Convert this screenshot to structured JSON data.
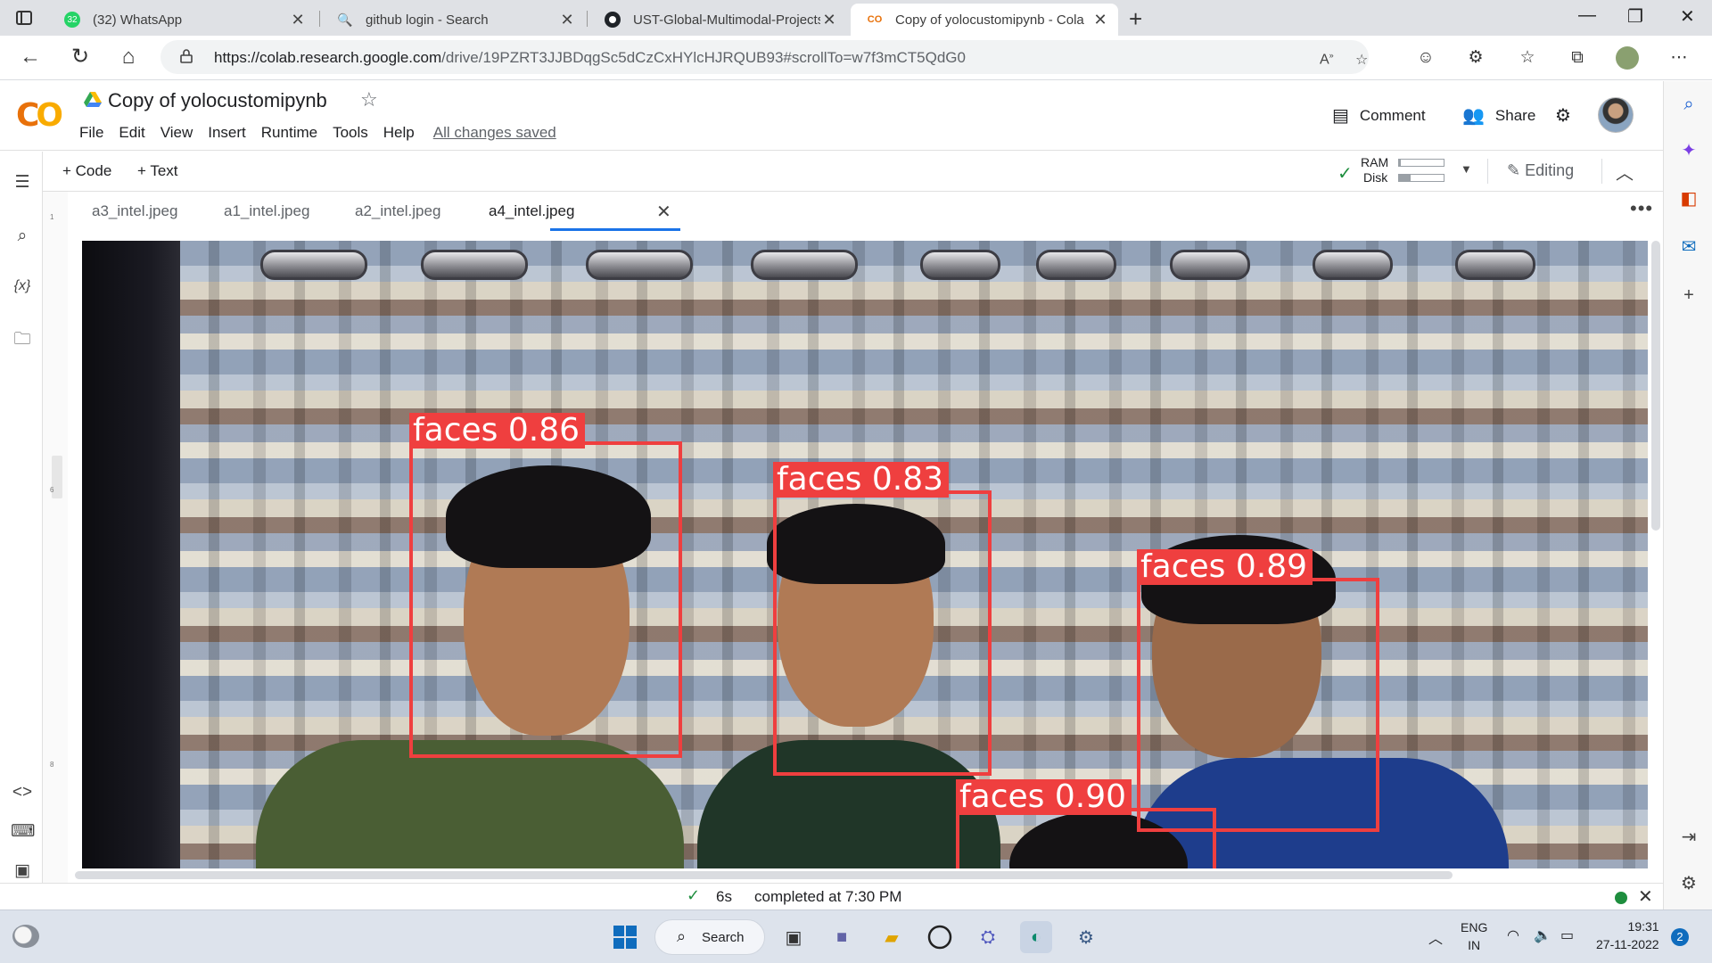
{
  "browser": {
    "tabs": [
      {
        "label": "(32) WhatsApp",
        "badge": "32",
        "icon": "whatsapp-icon"
      },
      {
        "label": "github login - Search",
        "icon": "search-icon"
      },
      {
        "label": "UST-Global-Multimodal-Projects",
        "icon": "github-icon"
      },
      {
        "label": "Copy of yolocustomipynb - Cola",
        "icon": "colab-icon",
        "active": true
      }
    ],
    "url_host": "https://colab.research.google.com",
    "url_path": "/drive/19PZRT3JJBDqgSc5dCzCxHYlcHJRQUB93#scrollTo=w7f3mCT5QdG0"
  },
  "colab": {
    "logo_text": "CO",
    "title": "Copy of yolocustomipynb",
    "menu": [
      "File",
      "Edit",
      "View",
      "Insert",
      "Runtime",
      "Tools",
      "Help"
    ],
    "saved_status": "All changes saved",
    "comment_label": "Comment",
    "share_label": "Share",
    "add_code_label": "+ Code",
    "add_text_label": "+ Text",
    "ram_label": "RAM",
    "disk_label": "Disk",
    "ram_fraction": 0.04,
    "disk_fraction": 0.25,
    "editing_label": "Editing",
    "gutter_labels": [
      "1",
      "6",
      "8"
    ]
  },
  "file_tabs": {
    "tabs": [
      "a3_intel.jpeg",
      "a1_intel.jpeg",
      "a2_intel.jpeg",
      "a4_intel.jpeg"
    ],
    "active_index": 3
  },
  "detections": [
    {
      "label": "faces 0.86"
    },
    {
      "label": "faces 0.83"
    },
    {
      "label": "faces 0.89"
    },
    {
      "label": "faces 0.90"
    }
  ],
  "status": {
    "duration": "6s",
    "message": "completed at 7:30 PM"
  },
  "taskbar": {
    "search_label": "Search",
    "lang_line1": "ENG",
    "lang_line2": "IN",
    "time": "19:31",
    "date": "27-11-2022",
    "notification_count": "2"
  },
  "colors": {
    "detection_box": "#ef3f3f",
    "colab_orange": "#e8710a",
    "colab_yellow": "#f9ab00",
    "accent_blue": "#1a73e8",
    "success_green": "#1e8e3e"
  }
}
